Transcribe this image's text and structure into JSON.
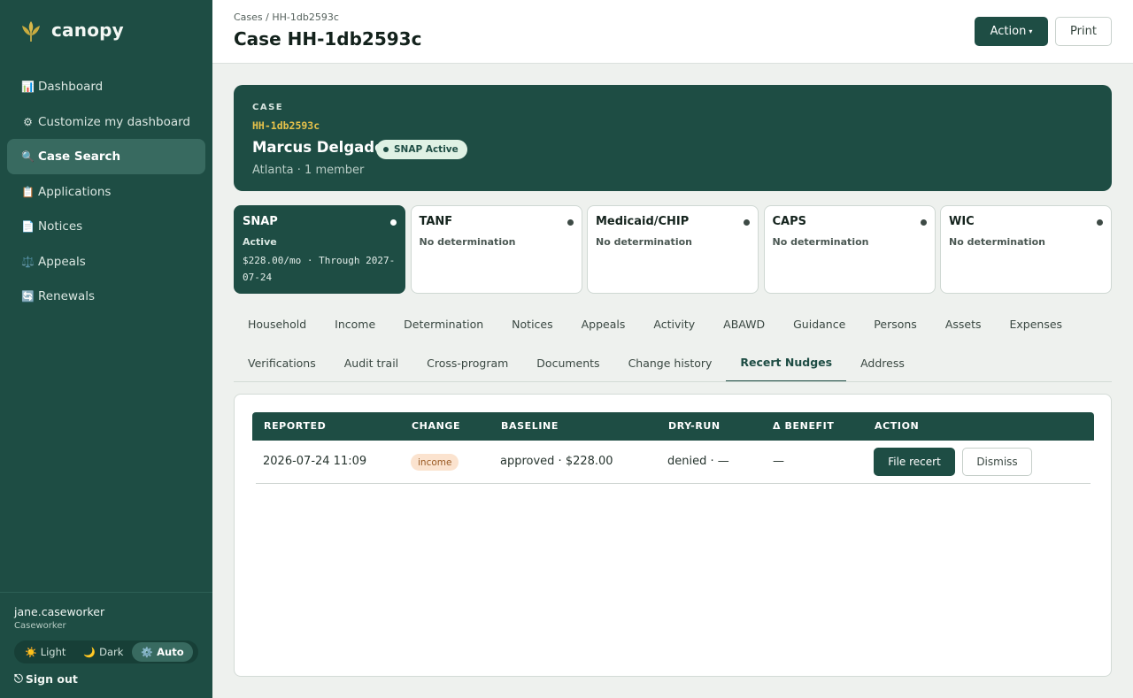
{
  "brand": {
    "name": "canopy",
    "logo_icon": "wheat-logo-icon",
    "accent": "#1e4d44",
    "logo_color": "#d8b84a"
  },
  "sidebar": {
    "items": [
      {
        "icon": "📊",
        "icon_name": "chart-icon",
        "label": "Dashboard",
        "active": false
      },
      {
        "icon": "⚙",
        "icon_name": "gear-icon",
        "label": "Customize my dashboard",
        "active": false
      },
      {
        "icon": "🔍",
        "icon_name": "search-icon",
        "label": "Case Search",
        "active": true
      },
      {
        "icon": "📋",
        "icon_name": "clipboard-icon",
        "label": "Applications",
        "active": false
      },
      {
        "icon": "📄",
        "icon_name": "document-icon",
        "label": "Notices",
        "active": false
      },
      {
        "icon": "⚖️",
        "icon_name": "scales-icon",
        "label": "Appeals",
        "active": false
      },
      {
        "icon": "🔄",
        "icon_name": "refresh-icon",
        "label": "Renewals",
        "active": false
      }
    ],
    "user": {
      "name": "jane.caseworker",
      "role": "Caseworker"
    },
    "theme": [
      {
        "icon": "☀️",
        "icon_name": "sun-icon",
        "label": "Light",
        "active": false
      },
      {
        "icon": "🌙",
        "icon_name": "moon-icon",
        "label": "Dark",
        "active": false
      },
      {
        "icon": "⚙️",
        "icon_name": "gear-icon",
        "label": "Auto",
        "active": true
      }
    ],
    "signout": {
      "icon": "⎋",
      "label": "Sign out"
    }
  },
  "header": {
    "breadcrumb": "Cases / HH-1db2593c",
    "title": "Case HH-1db2593c",
    "action_label": "Action",
    "action_caret": "▾",
    "print_label": "Print"
  },
  "case": {
    "eyebrow": "CASE",
    "id": "HH-1db2593c",
    "name": "Marcus Delgado",
    "badge": "SNAP Active",
    "meta": "Atlanta · 1 member"
  },
  "programs": [
    {
      "name": "SNAP",
      "status": "Active",
      "detail": "$228.00/mo · Through 2027-07-24",
      "active": true
    },
    {
      "name": "TANF",
      "status": "No determination",
      "detail": "",
      "active": false
    },
    {
      "name": "Medicaid/CHIP",
      "status": "No determination",
      "detail": "",
      "active": false
    },
    {
      "name": "CAPS",
      "status": "No determination",
      "detail": "",
      "active": false
    },
    {
      "name": "WIC",
      "status": "No determination",
      "detail": "",
      "active": false
    }
  ],
  "tabs_row1": [
    "Household",
    "Income",
    "Determination",
    "Notices",
    "Appeals",
    "Activity",
    "ABAWD",
    "Guidance",
    "Persons",
    "Assets",
    "Expenses"
  ],
  "tabs_row2": [
    "Verifications",
    "Audit trail",
    "Cross-program",
    "Documents",
    "Change history",
    "Recert Nudges",
    "Address"
  ],
  "active_tab": "Recert Nudges",
  "nudges": {
    "columns": [
      "REPORTED",
      "CHANGE",
      "BASELINE",
      "DRY-RUN",
      "Δ BENEFIT",
      "ACTION"
    ],
    "rows": [
      {
        "reported": "2026-07-24 11:09",
        "change": "income",
        "baseline": "approved · $228.00",
        "dry_run": "denied · —",
        "delta": "—",
        "primary_action": "File recert",
        "secondary_action": "Dismiss"
      }
    ]
  }
}
